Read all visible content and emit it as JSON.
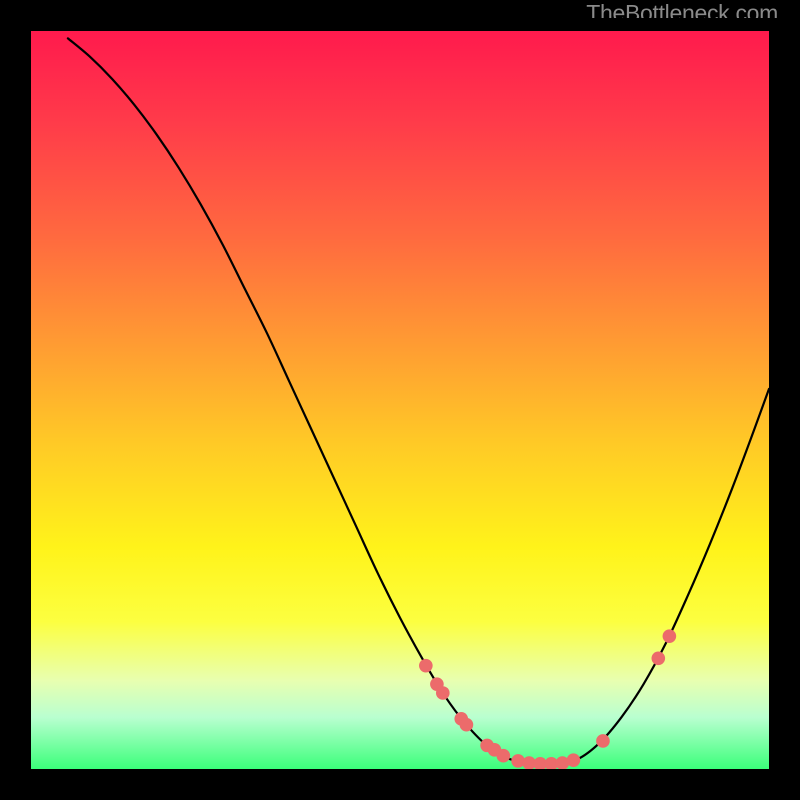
{
  "watermark": "TheBottleneck.com",
  "colors": {
    "curve": "#000000",
    "dot": "#ec6b6b",
    "dot_stroke": "#d94f4f"
  },
  "chart_data": {
    "type": "line",
    "title": "",
    "xlabel": "",
    "ylabel": "",
    "xlim": [
      0,
      100
    ],
    "ylim": [
      0,
      100
    ],
    "curve": [
      {
        "x": 5.0,
        "y": 99.0
      },
      {
        "x": 8.0,
        "y": 96.5
      },
      {
        "x": 11.0,
        "y": 93.5
      },
      {
        "x": 14.0,
        "y": 90.0
      },
      {
        "x": 17.0,
        "y": 86.0
      },
      {
        "x": 20.0,
        "y": 81.5
      },
      {
        "x": 23.0,
        "y": 76.5
      },
      {
        "x": 26.0,
        "y": 71.0
      },
      {
        "x": 29.0,
        "y": 65.0
      },
      {
        "x": 32.0,
        "y": 59.0
      },
      {
        "x": 35.0,
        "y": 52.5
      },
      {
        "x": 38.0,
        "y": 46.0
      },
      {
        "x": 41.0,
        "y": 39.5
      },
      {
        "x": 44.0,
        "y": 33.0
      },
      {
        "x": 47.0,
        "y": 26.5
      },
      {
        "x": 50.0,
        "y": 20.5
      },
      {
        "x": 53.0,
        "y": 15.0
      },
      {
        "x": 56.0,
        "y": 10.0
      },
      {
        "x": 59.0,
        "y": 6.0
      },
      {
        "x": 62.0,
        "y": 3.0
      },
      {
        "x": 65.0,
        "y": 1.3
      },
      {
        "x": 68.0,
        "y": 0.7
      },
      {
        "x": 71.0,
        "y": 0.7
      },
      {
        "x": 74.0,
        "y": 1.3
      },
      {
        "x": 77.0,
        "y": 3.5
      },
      {
        "x": 80.0,
        "y": 7.0
      },
      {
        "x": 83.0,
        "y": 11.5
      },
      {
        "x": 86.0,
        "y": 17.0
      },
      {
        "x": 89.0,
        "y": 23.5
      },
      {
        "x": 92.0,
        "y": 30.5
      },
      {
        "x": 95.0,
        "y": 38.0
      },
      {
        "x": 98.0,
        "y": 46.0
      },
      {
        "x": 100.0,
        "y": 51.5
      }
    ],
    "dots": [
      {
        "x": 53.5,
        "y": 14.0
      },
      {
        "x": 55.0,
        "y": 11.5
      },
      {
        "x": 55.8,
        "y": 10.3
      },
      {
        "x": 58.3,
        "y": 6.8
      },
      {
        "x": 59.0,
        "y": 6.0
      },
      {
        "x": 61.8,
        "y": 3.2
      },
      {
        "x": 62.8,
        "y": 2.6
      },
      {
        "x": 64.0,
        "y": 1.8
      },
      {
        "x": 66.0,
        "y": 1.1
      },
      {
        "x": 67.5,
        "y": 0.8
      },
      {
        "x": 69.0,
        "y": 0.7
      },
      {
        "x": 70.5,
        "y": 0.7
      },
      {
        "x": 72.0,
        "y": 0.8
      },
      {
        "x": 73.5,
        "y": 1.2
      },
      {
        "x": 77.5,
        "y": 3.8
      },
      {
        "x": 85.0,
        "y": 15.0
      },
      {
        "x": 86.5,
        "y": 18.0
      }
    ]
  }
}
